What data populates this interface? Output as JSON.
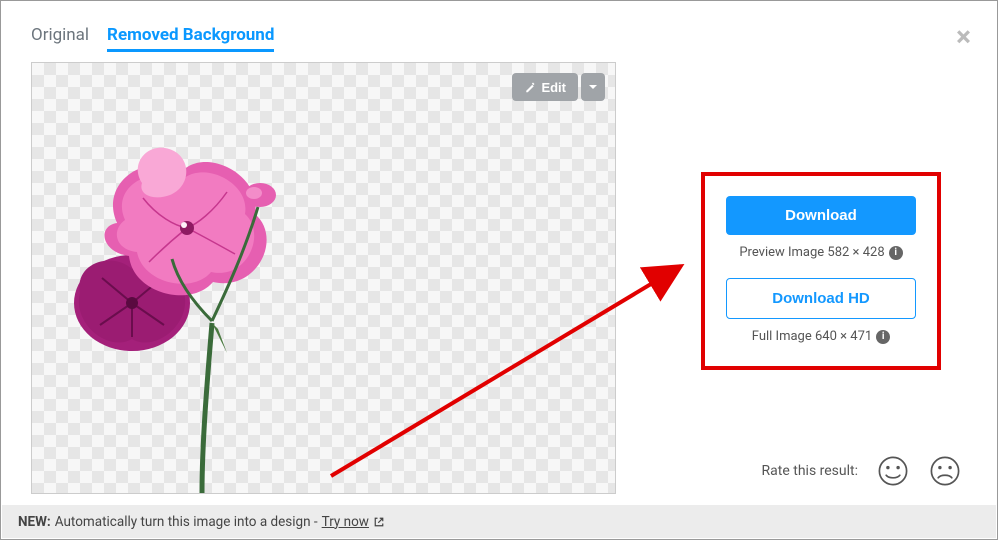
{
  "close": "×",
  "tabs": {
    "original": "Original",
    "removed": "Removed Background"
  },
  "edit": {
    "label": "Edit"
  },
  "download": {
    "primary": "Download",
    "caption1": "Preview Image 582 × 428",
    "secondary": "Download HD",
    "caption2": "Full Image 640 × 471"
  },
  "rate": {
    "label": "Rate this result:"
  },
  "footer": {
    "new": "NEW:",
    "text": "Automatically turn this image into a design -",
    "link": "Try now"
  }
}
